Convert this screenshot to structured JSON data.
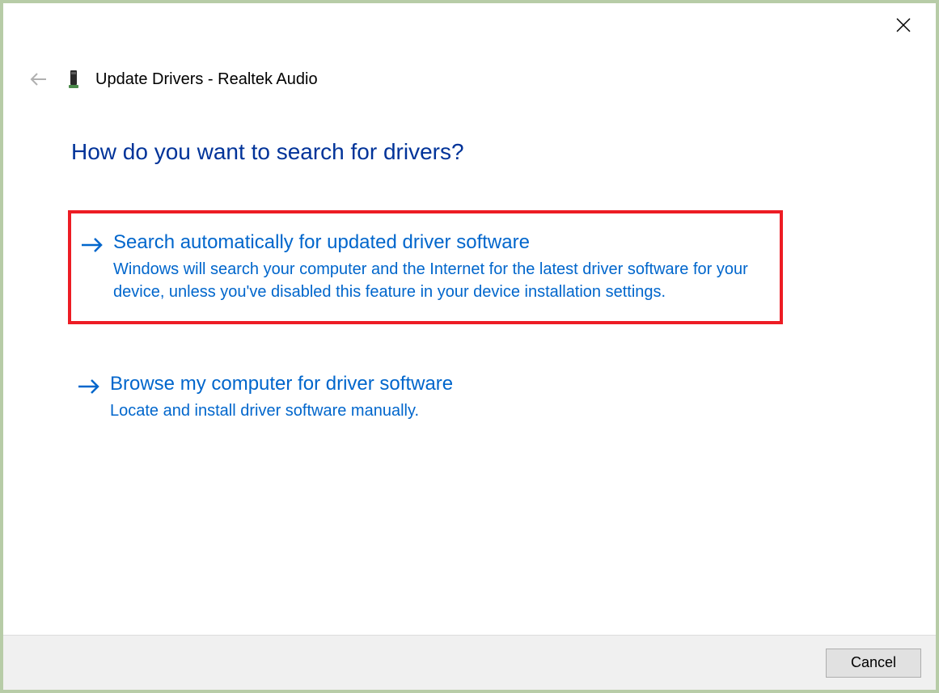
{
  "window": {
    "title": "Update Drivers - Realtek Audio"
  },
  "main": {
    "heading": "How do you want to search for drivers?"
  },
  "options": [
    {
      "title": "Search automatically for updated driver software",
      "description": "Windows will search your computer and the Internet for the latest driver software for your device, unless you've disabled this feature in your device installation settings.",
      "highlighted": true
    },
    {
      "title": "Browse my computer for driver software",
      "description": "Locate and install driver software manually.",
      "highlighted": false
    }
  ],
  "footer": {
    "cancel_label": "Cancel"
  }
}
